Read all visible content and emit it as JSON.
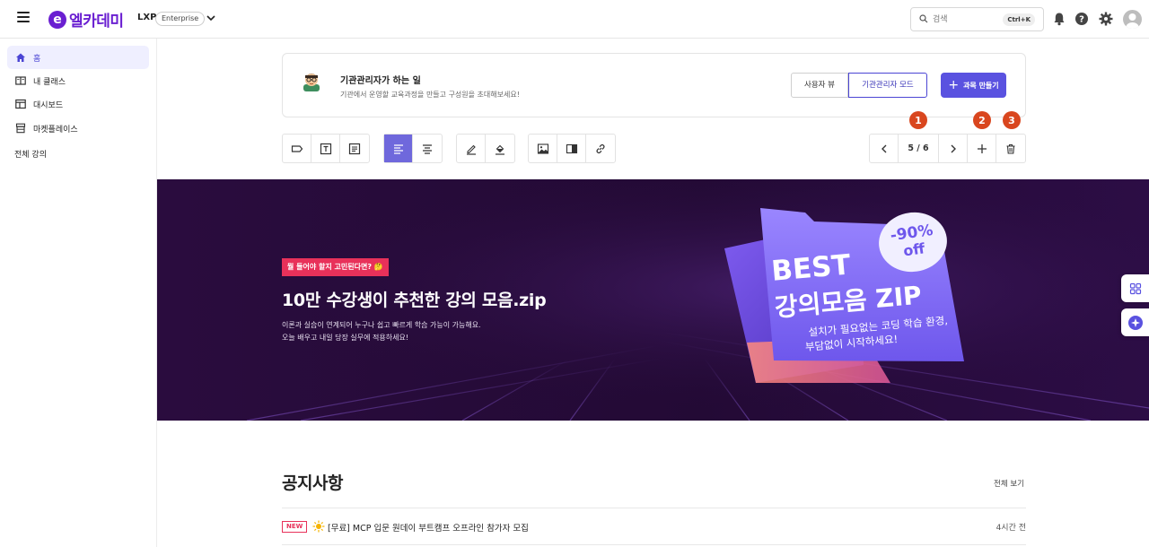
{
  "header": {
    "logo_mark": "e",
    "logo_text": "엘카데미",
    "product": "LXP",
    "plan_badge": "Enterprise",
    "search_placeholder": "검색",
    "search_shortcut": "Ctrl+K"
  },
  "sidebar": {
    "items": [
      {
        "label": "홈",
        "icon": "home-icon",
        "active": true
      },
      {
        "label": "내 클래스",
        "icon": "book-icon"
      },
      {
        "label": "대시보드",
        "icon": "dashboard-icon"
      },
      {
        "label": "마켓플레이스",
        "icon": "store-icon"
      }
    ],
    "all_courses": "전체 강의"
  },
  "admin_card": {
    "title": "기관관리자가 하는 일",
    "subtitle": "기관에서 운영할 교육과정을 만들고 구성원을 초대해보세요!",
    "user_view": "사용자 뷰",
    "admin_mode": "기관관리자 모드",
    "create_course": "과목 만들기"
  },
  "toolbar": {
    "page_indicator": "5 / 6",
    "markers": [
      "1",
      "2",
      "3"
    ]
  },
  "banner": {
    "tag": "뭘 들어야 할지 고민된다면? 🤔",
    "title": "10만 수강생이 추천한 강의 모음.zip",
    "desc_line1": "이론과 실습이 연계되어 누구나 쉽고 빠르게 학습 가능이 가능해요.",
    "desc_line2": "오늘 배우고 내일 당장 실무에 적용하세요!",
    "art_discount": "-90%",
    "art_off": "off",
    "art_best": "BEST",
    "art_title": "강의모음 ZIP",
    "art_sub1": "설치가 필요없는 코딩 학습 환경,",
    "art_sub2": "부담없이 시작하세요!"
  },
  "notice": {
    "title": "공지사항",
    "view_all": "전체 보기",
    "items": [
      {
        "badge": "NEW",
        "text": "[무료] MCP 입문 원데이 부트캠프 오프라인 참가자 모집",
        "time": "4시간 전"
      }
    ]
  },
  "colors": {
    "brand": "#6a1fd1",
    "accent": "#5a52e0",
    "marker": "#d9461e",
    "new_badge": "#e8315a"
  }
}
